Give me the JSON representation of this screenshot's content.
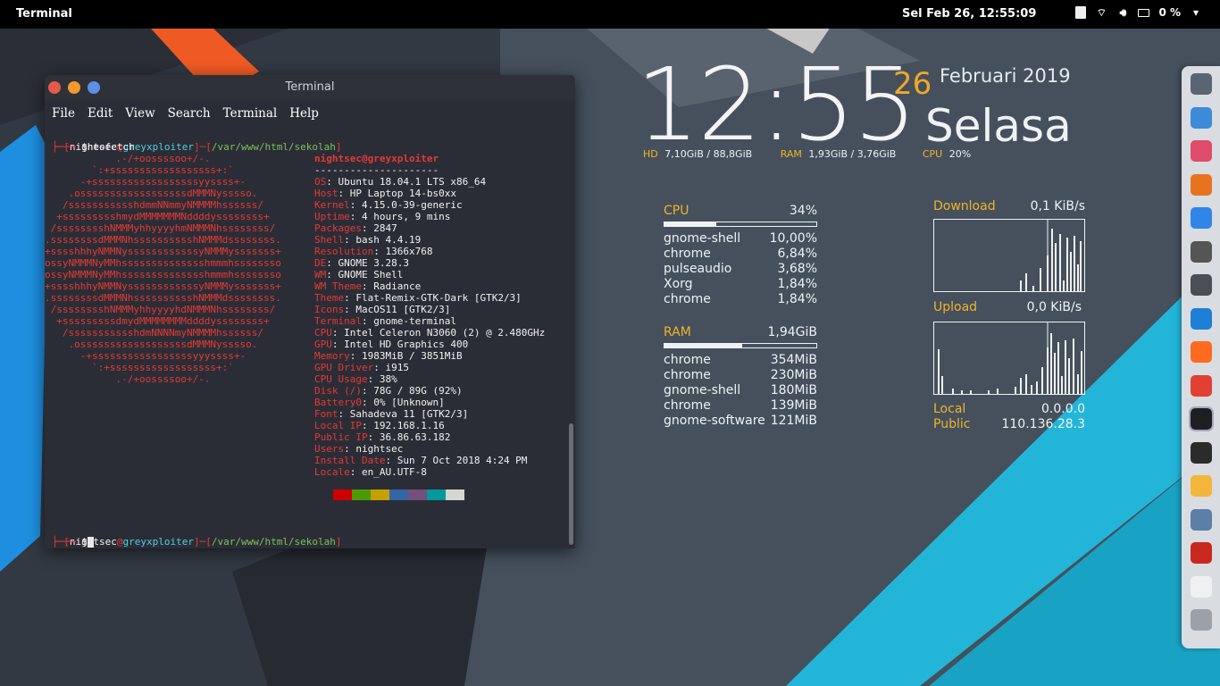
{
  "topbar": {
    "app_name": "Terminal",
    "clock": "Sel Feb 26, 12:55:09",
    "battery": "0 %"
  },
  "terminal": {
    "title": "Terminal",
    "menu": [
      "File",
      "Edit",
      "View",
      "Search",
      "Terminal",
      "Help"
    ],
    "user": "nightsec",
    "at": "@",
    "host": "greyxploiter",
    "path": "/var/www/html/sekolah",
    "command": "$neofetch",
    "prompt_symbol": "$",
    "logo_lines": [
      "            .-/+oossssoo+/-.",
      "        `:+ssssssssssssssssss+:`",
      "      -+ssssssssssssssssssyyssss+-",
      "    .ossssssssssssssssssdMMMNysssso.",
      "   /ssssssssssshdmmNNmmyNMMMMhssssss/",
      "  +ssssssssshmydMMMMMMMNddddyssssssss+",
      " /sssssssshNMMMyhhyyyyhmNMMMNhssssssss/",
      ".ssssssssdMMMNhsssssssssshNMMMdssssssss.",
      "+sssshhhyNMMNyssssssssssssyNMMMysssssss+",
      "ossyNMMMNyMMhsssssssssssssshmmmhssssssso",
      "ossyNMMMNyMMhsssssssssssssshmmmhssssssso",
      "+sssshhhyNMMNyssssssssssssyNMMMysssssss+",
      ".ssssssssdMMMNhsssssssssshNMMMdssssssss.",
      " /sssssssshNMMMyhhyyyyhdNMMMNhssssssss/",
      "  +sssssssssdmydMMMMMMMMddddyssssssss+",
      "   /ssssssssssshdmNNNNmyNMMMMhssssss/",
      "    .ossssssssssssssssssdMMMNysssso.",
      "      -+sssssssssssssssssyyyssss+-",
      "        `:+ssssssssssssssssss+:`",
      "            .-/+oossssoo+/-."
    ],
    "info_header": "nightsec@greyxploiter",
    "info_sep": "---------------------",
    "info": [
      {
        "k": "OS",
        "v": "Ubuntu 18.04.1 LTS x86_64"
      },
      {
        "k": "Host",
        "v": "HP Laptop 14-bs0xx"
      },
      {
        "k": "Kernel",
        "v": "4.15.0-39-generic"
      },
      {
        "k": "Uptime",
        "v": "4 hours, 9 mins"
      },
      {
        "k": "Packages",
        "v": "2847"
      },
      {
        "k": "Shell",
        "v": "bash 4.4.19"
      },
      {
        "k": "Resolution",
        "v": "1366x768"
      },
      {
        "k": "DE",
        "v": "GNOME 3.28.3"
      },
      {
        "k": "WM",
        "v": "GNOME Shell"
      },
      {
        "k": "WM Theme",
        "v": "Radiance"
      },
      {
        "k": "Theme",
        "v": "Flat-Remix-GTK-Dark [GTK2/3]"
      },
      {
        "k": "Icons",
        "v": "MacOS11 [GTK2/3]"
      },
      {
        "k": "Terminal",
        "v": "gnome-terminal"
      },
      {
        "k": "CPU",
        "v": "Intel Celeron N3060 (2) @ 2.480GHz"
      },
      {
        "k": "GPU",
        "v": "Intel HD Graphics 400"
      },
      {
        "k": "Memory",
        "v": "1983MiB / 3851MiB"
      },
      {
        "k": "GPU Driver",
        "v": "i915"
      },
      {
        "k": "CPU Usage",
        "v": "38%"
      },
      {
        "k": "Disk (/)",
        "v": "78G / 89G (92%)"
      },
      {
        "k": "Battery0",
        "v": "0% [Unknown]"
      },
      {
        "k": "Font",
        "v": "Sahadeva 11 [GTK2/3]"
      },
      {
        "k": "Local IP",
        "v": "192.168.1.16"
      },
      {
        "k": "Public IP",
        "v": "36.86.63.182"
      },
      {
        "k": "Users",
        "v": "nightsec"
      },
      {
        "k": "Install Date",
        "v": "Sun 7 Oct 2018 4:24 PM"
      },
      {
        "k": "Locale",
        "v": "en_AU.UTF-8"
      }
    ],
    "palette": [
      "#2b2d36",
      "#cc0000",
      "#4e9a06",
      "#c4a000",
      "#3465a4",
      "#75507b",
      "#06989a",
      "#d3d7cf"
    ]
  },
  "conky": {
    "time": "12:55",
    "day": "26",
    "month_year": "Februari 2019",
    "weekday": "Selasa",
    "hd_label": "HD",
    "hd_value": "7,10GiB / 88,8GiB",
    "ram_label": "RAM",
    "ram_value": "1,93GiB / 3,76GiB",
    "cpu_label": "CPU",
    "cpu_value": "20%",
    "cpu_section": {
      "title": "CPU",
      "value": "34%",
      "usage_fraction": 0.34,
      "processes": [
        {
          "name": "gnome-shell",
          "value": "10,00%"
        },
        {
          "name": "chrome",
          "value": "6,84%"
        },
        {
          "name": "pulseaudio",
          "value": "3,68%"
        },
        {
          "name": "Xorg",
          "value": "1,84%"
        },
        {
          "name": "chrome",
          "value": "1,84%"
        }
      ]
    },
    "ram_section": {
      "title": "RAM",
      "value": "1,94GiB",
      "usage_fraction": 0.51,
      "processes": [
        {
          "name": "chrome",
          "value": "354MiB"
        },
        {
          "name": "chrome",
          "value": "230MiB"
        },
        {
          "name": "gnome-shell",
          "value": "180MiB"
        },
        {
          "name": "chrome",
          "value": "139MiB"
        },
        {
          "name": "gnome-software",
          "value": "121MiB"
        }
      ]
    },
    "network": {
      "download_label": "Download",
      "download_value": "0,1 KiB/s",
      "upload_label": "Upload",
      "upload_value": "0,0 KiB/s",
      "local_label": "Local",
      "local_value": "0.0.0.0",
      "public_label": "Public",
      "public_value": "110.136.28.3"
    }
  },
  "dock": {
    "apps": [
      "app-grid-icon",
      "files-icon",
      "music-icon",
      "presentation-icon",
      "app-store-icon",
      "amazon-icon",
      "settings-icon",
      "mysql-workbench-icon",
      "firefox-icon",
      "chrome-icon",
      "terminal-icon",
      "code-editor-icon",
      "image-editor-icon",
      "screenshot-icon",
      "filezilla-icon",
      "text-editor-icon",
      "trash-icon"
    ]
  }
}
